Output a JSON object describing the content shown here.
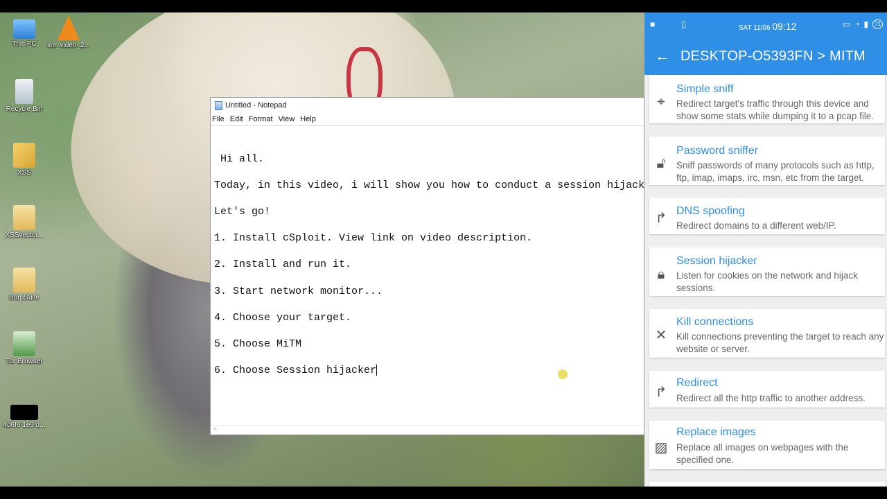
{
  "desktop": {
    "icons": [
      {
        "label": "This PC",
        "icon": "this-pc-icon",
        "color": "#3a8ee0"
      },
      {
        "label": "ice_video_2...",
        "icon": "vlc-icon",
        "color": "#f08a1c"
      },
      {
        "label": "Recycle Bin",
        "icon": "recycle-bin-icon",
        "color": "#c9d3dc"
      },
      {
        "label": "XSS",
        "icon": "chrome-icon",
        "color": "#e2b340"
      },
      {
        "label": "XSSvector...",
        "icon": "folder-icon",
        "color": "#e9c977"
      },
      {
        "label": "BurpSuite",
        "icon": "folder-icon",
        "color": "#e9c977"
      },
      {
        "label": "Tor Browser",
        "icon": "tor-browser-icon",
        "color": "#4f9a48"
      },
      {
        "label": "4d6f6 1e9 d...",
        "icon": "file-icon",
        "color": "#000000"
      }
    ]
  },
  "notepad": {
    "title": "Untitled - Notepad",
    "menu": [
      "File",
      "Edit",
      "Format",
      "View",
      "Help"
    ],
    "lines": [
      " Hi all.",
      "Today, in this video, i will show you how to conduct a session hijacking",
      "Let's go!",
      "1. Install cSploit. View link on video description.",
      "2. Install and run it.",
      "3. Start network monitor...",
      "4. Choose your target.",
      "5. Choose MiTM",
      "6. Choose Session hijacker"
    ]
  },
  "phone": {
    "status": {
      "day": "SAT 11/06",
      "time": "09:12",
      "battery": "71"
    },
    "title": "DESKTOP-O5393FN > MITM",
    "items": [
      {
        "title": "Simple sniff",
        "desc": "Redirect target's traffic through this device and show some stats while dumping it to a pcap file.",
        "icon": "crosshair-icon"
      },
      {
        "title": "Password sniffer",
        "desc": "Sniff passwords of many protocols such as http, ftp, imap, imaps, irc, msn, etc from the target.",
        "icon": "lock-open-icon"
      },
      {
        "title": "DNS spoofing",
        "desc": "Redirect domains to a different web/IP.",
        "icon": "redirect-arrow-icon"
      },
      {
        "title": "Session hijacker",
        "desc": "Listen for cookies on the network and hijack sessions.",
        "icon": "lock-icon"
      },
      {
        "title": "Kill connections",
        "desc": "Kill connections preventing the target to reach any website or server.",
        "icon": "close-icon"
      },
      {
        "title": "Redirect",
        "desc": "Redirect all the http traffic to another address.",
        "icon": "redirect-arrow-icon"
      },
      {
        "title": "Replace images",
        "desc": "Replace all images on webpages with the specified one.",
        "icon": "image-icon"
      }
    ]
  },
  "colors": {
    "accent": "#2f8ee6"
  }
}
